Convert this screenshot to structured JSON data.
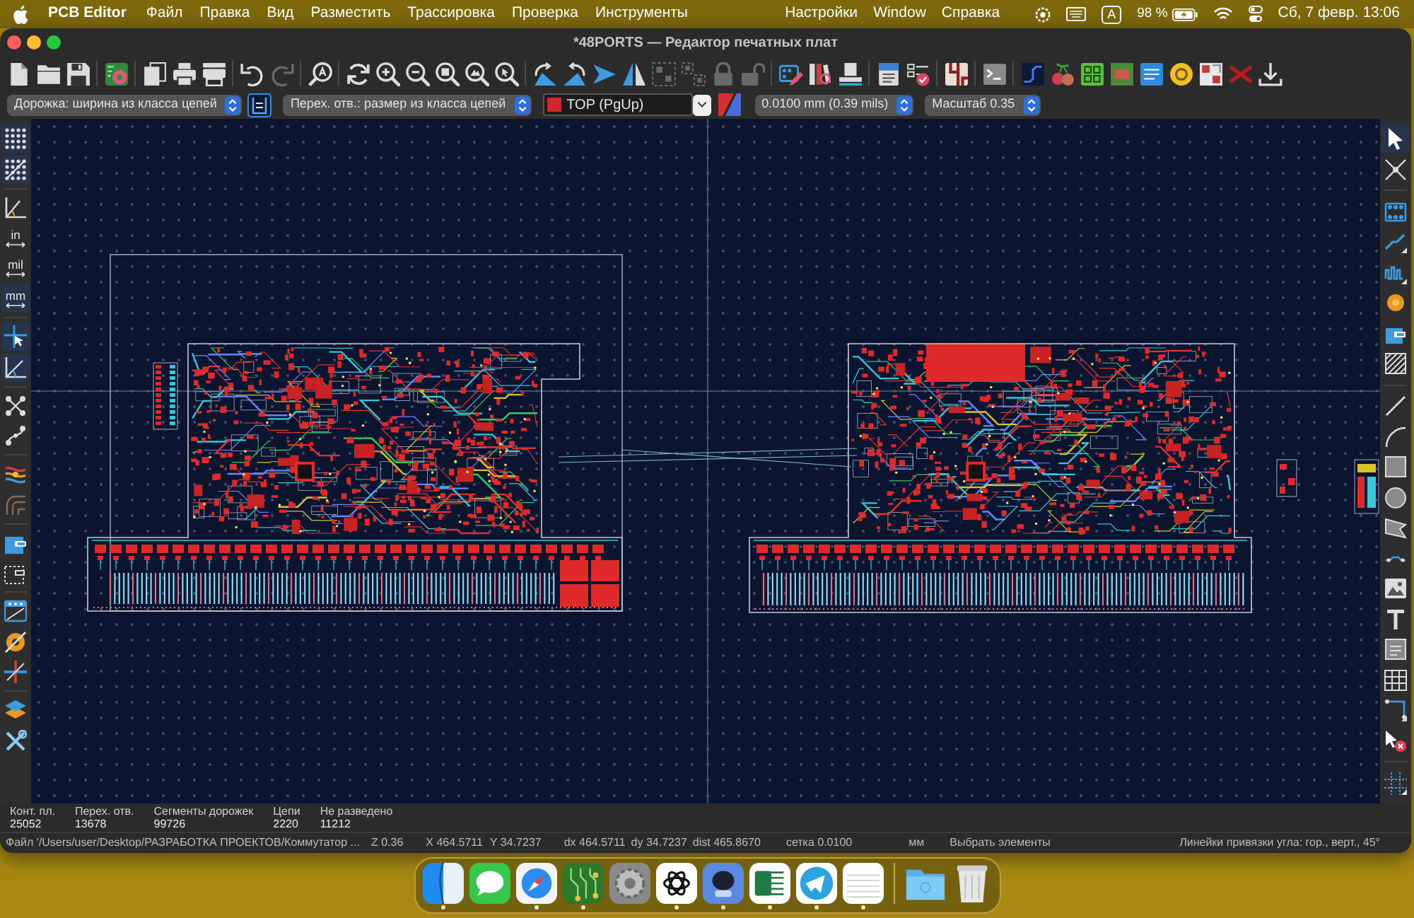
{
  "menu_bar": {
    "app_name": "PCB Editor",
    "menus_left": [
      "Файл",
      "Правка",
      "Вид",
      "Разместить",
      "Трассировка",
      "Проверка",
      "Инструменты"
    ],
    "menus_right": [
      "Настройки",
      "Window",
      "Справка"
    ],
    "input_source": "A",
    "battery": "98 %",
    "clock": "Сб, 7 февр. 13:06"
  },
  "window": {
    "title": "*48PORTS — Редактор печатных плат"
  },
  "toolbar": [
    {
      "disabled": false
    },
    {
      "disabled": false
    },
    {
      "disabled": false
    },
    {
      "disabled": false
    },
    {
      "disabled": false
    },
    {
      "disabled": false
    },
    {
      "disabled": false
    },
    {
      "disabled": false
    },
    {
      "disabled": true
    },
    {
      "disabled": false
    },
    {
      "disabled": false
    },
    {
      "disabled": false
    },
    {
      "disabled": false
    },
    {
      "disabled": false
    },
    {
      "disabled": false
    },
    {
      "disabled": false
    },
    {
      "disabled": false
    },
    {
      "disabled": false
    },
    {
      "disabled": false
    },
    {
      "disabled": false
    },
    {
      "disabled": true
    },
    {
      "disabled": true
    },
    {
      "disabled": true
    },
    {
      "disabled": true
    },
    {
      "disabled": false
    },
    {
      "disabled": false
    },
    {
      "disabled": false
    },
    {
      "disabled": false
    },
    {
      "disabled": false
    },
    {
      "disabled": false
    },
    {
      "disabled": false
    },
    {
      "disabled": false
    },
    {
      "disabled": false
    },
    {
      "disabled": false
    },
    {
      "disabled": false
    },
    {
      "disabled": false
    },
    {
      "disabled": false
    },
    {
      "disabled": false
    },
    {
      "disabled": false
    },
    {
      "disabled": false
    }
  ],
  "options_bar": {
    "track_width": "Дорожка: ширина из класса цепей",
    "auto_track_width": {
      "selected": true
    },
    "via_size": "Перех. отв.: размер из класса цепей",
    "layer": {
      "label": "TOP (PgUp)",
      "color": "#d02828"
    },
    "grid": "0.0100 mm (0.39 mils)",
    "zoom": "Масштаб 0.35"
  },
  "left_toolbar": [
    {
      "selected": true
    },
    {
      "selected": true
    },
    {
      "selected": false
    },
    {
      "selected": false,
      "label": "in"
    },
    {
      "selected": false,
      "label": "mil"
    },
    {
      "selected": true,
      "label": "mm"
    },
    {
      "selected": true
    },
    {
      "selected": true
    },
    {
      "selected": false
    },
    {
      "selected": false
    },
    {
      "selected": false
    },
    {
      "selected": false
    },
    {
      "selected": false
    },
    {
      "selected": false
    },
    {
      "selected": false
    },
    {
      "selected": false
    },
    {
      "selected": false
    },
    {
      "selected": false
    },
    {
      "selected": false
    }
  ],
  "right_toolbar": [
    {
      "selected": true
    },
    {
      "selected": false
    },
    {
      "selected": false
    },
    {
      "selected": false
    },
    {
      "selected": false
    },
    {
      "selected": false
    },
    {
      "selected": false
    },
    {
      "selected": false
    },
    {
      "selected": false
    },
    {
      "selected": false
    },
    {
      "selected": false
    },
    {
      "selected": false
    },
    {
      "selected": false
    },
    {
      "selected": false
    },
    {
      "selected": false
    },
    {
      "selected": false
    },
    {
      "selected": false
    },
    {
      "selected": false
    },
    {
      "selected": false
    },
    {
      "selected": false
    },
    {
      "selected": false
    }
  ],
  "messages": [
    {
      "label": "Конт. пл.",
      "value": "25052"
    },
    {
      "label": "Перех. отв.",
      "value": "13678"
    },
    {
      "label": "Сегменты дорожек",
      "value": "99726"
    },
    {
      "label": "Цепи",
      "value": "2220"
    },
    {
      "label": "Не разведено",
      "value": "11212"
    }
  ],
  "status_bar": [
    "Файл '/Users/user/Desktop/РАЗРАБОТКА ПРОЕКТОВ/Коммутатор ...",
    "Z 0.36",
    "X 464.5711",
    "Y 34.7237",
    "dx 464.5711",
    "dy 34.7237",
    "dist 465.8670",
    "сетка 0.0100",
    "мм",
    "Выбрать элементы",
    "Линейки привязки угла: гор., верт., 45°"
  ],
  "dock": [
    {
      "running": true
    },
    {
      "running": false
    },
    {
      "running": true
    },
    {
      "running": true
    },
    {
      "running": false
    },
    {
      "running": true
    },
    {
      "running": true
    },
    {
      "running": true
    },
    {
      "running": true
    },
    {
      "running": true
    },
    {
      "running": false
    },
    {
      "running": false
    }
  ]
}
